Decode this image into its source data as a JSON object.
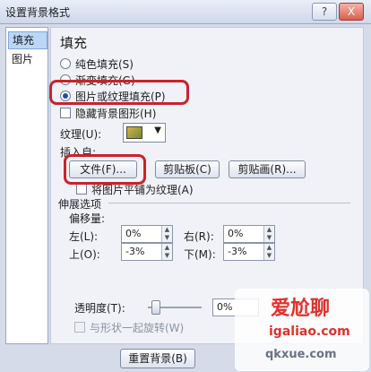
{
  "window": {
    "title": "设置背景格式",
    "help": "?",
    "close": "X"
  },
  "nav": {
    "items": [
      {
        "label": "填充"
      },
      {
        "label": "图片"
      }
    ]
  },
  "fill": {
    "heading": "填充",
    "options": [
      {
        "label": "纯色填充(S)",
        "selected": false
      },
      {
        "label": "渐变填充(G)",
        "selected": false
      },
      {
        "label": "图片或纹理填充(P)",
        "selected": true
      }
    ],
    "hide_bg_label": "隐藏背景图形(H)",
    "texture_label": "纹理(U):",
    "insert_from_label": "插入自:",
    "file_button": "文件(F)...",
    "clipboard_button": "剪贴板(C)",
    "clipart_button": "剪贴画(R)...",
    "tile_label": "将图片平铺为纹理(A)",
    "stretch_heading": "伸展选项",
    "offset_label": "偏移量:",
    "left_label": "左(L):",
    "left_value": "0%",
    "right_label": "右(R):",
    "right_value": "0%",
    "top_label": "上(O):",
    "top_value": "-3%",
    "bottom_label": "下(M):",
    "bottom_value": "-3%",
    "transparency_label": "透明度(T):",
    "transparency_value": "0%",
    "rotate_label": "与形状一起旋转(W)"
  },
  "footer": {
    "reset_button": "重置背景(B)"
  },
  "watermark": {
    "site1": "爱尬聊",
    "site2": "igaliao.com",
    "site3": "qkxue.com"
  },
  "colors": {
    "highlight_ring": "#c8232c",
    "dialog_bg": "#f0f2f7",
    "title_bg": "#dfe6f3"
  }
}
